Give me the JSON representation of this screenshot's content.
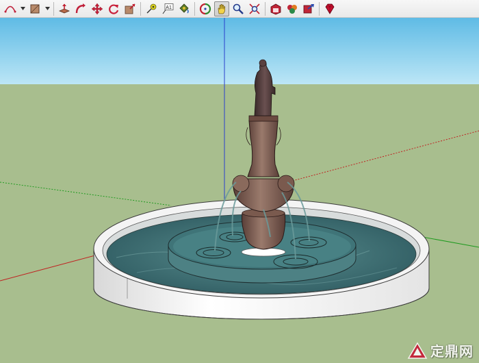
{
  "toolbar": {
    "tools": [
      {
        "name": "arc-tool",
        "icon": "arc-icon"
      },
      {
        "name": "rectangle-tool",
        "icon": "rectangle-icon"
      },
      {
        "name": "push-pull-tool",
        "icon": "push-pull-icon"
      },
      {
        "name": "follow-me-tool",
        "icon": "follow-me-icon"
      },
      {
        "name": "move-tool",
        "icon": "move-icon"
      },
      {
        "name": "rotate-tool",
        "icon": "rotate-icon"
      },
      {
        "name": "scale-tool",
        "icon": "scale-icon"
      },
      {
        "name": "tape-measure-tool",
        "icon": "tape-measure-icon"
      },
      {
        "name": "text-tool",
        "icon": "text-icon",
        "label": "A1"
      },
      {
        "name": "paint-bucket-tool",
        "icon": "paint-bucket-icon"
      },
      {
        "name": "orbit-tool",
        "icon": "orbit-icon"
      },
      {
        "name": "pan-tool",
        "icon": "pan-hand-icon",
        "active": true
      },
      {
        "name": "zoom-tool",
        "icon": "zoom-icon"
      },
      {
        "name": "zoom-extents-tool",
        "icon": "zoom-extents-icon"
      },
      {
        "name": "warehouse-tool",
        "icon": "3d-warehouse-icon"
      },
      {
        "name": "components-tool",
        "icon": "components-icon"
      },
      {
        "name": "share-model-tool",
        "icon": "share-model-icon"
      },
      {
        "name": "ruby-console-tool",
        "icon": "ruby-icon"
      }
    ]
  },
  "colors": {
    "sky": "#8fd3ec",
    "ground": "#a9bf8f",
    "axis_blue": "#2a3fcc",
    "axis_red": "#c02020",
    "axis_green": "#1e9a1e",
    "water": "#3f7276",
    "stone": "#7a5a4e",
    "rim": "#f0f0f0"
  },
  "watermark": {
    "text": "定鼎网"
  }
}
